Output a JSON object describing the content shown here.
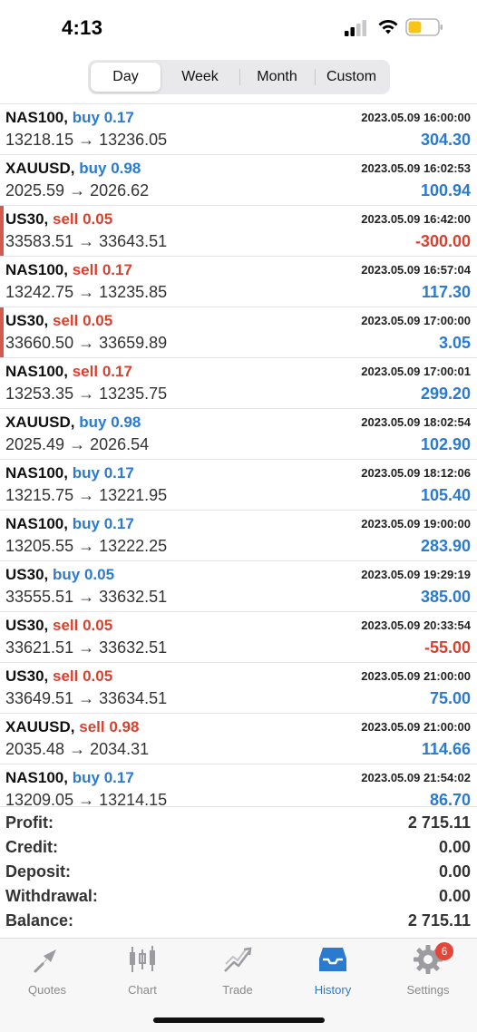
{
  "status_bar": {
    "time": "4:13"
  },
  "segments": [
    "Day",
    "Week",
    "Month",
    "Custom"
  ],
  "active_segment": "Day",
  "deals": [
    {
      "symbol": "NAS100,",
      "side": "buy",
      "volume": "0.17",
      "open": "13218.15",
      "close": "13236.05",
      "datetime": "2023.05.09 16:00:00",
      "profit": "304.30",
      "profit_sign": "pos",
      "marker": false
    },
    {
      "symbol": "XAUUSD,",
      "side": "buy",
      "volume": "0.98",
      "open": "2025.59",
      "close": "2026.62",
      "datetime": "2023.05.09 16:02:53",
      "profit": "100.94",
      "profit_sign": "pos",
      "marker": false
    },
    {
      "symbol": "US30,",
      "side": "sell",
      "volume": "0.05",
      "open": "33583.51",
      "close": "33643.51",
      "datetime": "2023.05.09 16:42:00",
      "profit": "-300.00",
      "profit_sign": "neg",
      "marker": true
    },
    {
      "symbol": "NAS100,",
      "side": "sell",
      "volume": "0.17",
      "open": "13242.75",
      "close": "13235.85",
      "datetime": "2023.05.09 16:57:04",
      "profit": "117.30",
      "profit_sign": "pos",
      "marker": false
    },
    {
      "symbol": "US30,",
      "side": "sell",
      "volume": "0.05",
      "open": "33660.50",
      "close": "33659.89",
      "datetime": "2023.05.09 17:00:00",
      "profit": "3.05",
      "profit_sign": "pos",
      "marker": true
    },
    {
      "symbol": "NAS100,",
      "side": "sell",
      "volume": "0.17",
      "open": "13253.35",
      "close": "13235.75",
      "datetime": "2023.05.09 17:00:01",
      "profit": "299.20",
      "profit_sign": "pos",
      "marker": false
    },
    {
      "symbol": "XAUUSD,",
      "side": "buy",
      "volume": "0.98",
      "open": "2025.49",
      "close": "2026.54",
      "datetime": "2023.05.09 18:02:54",
      "profit": "102.90",
      "profit_sign": "pos",
      "marker": false
    },
    {
      "symbol": "NAS100,",
      "side": "buy",
      "volume": "0.17",
      "open": "13215.75",
      "close": "13221.95",
      "datetime": "2023.05.09 18:12:06",
      "profit": "105.40",
      "profit_sign": "pos",
      "marker": false
    },
    {
      "symbol": "NAS100,",
      "side": "buy",
      "volume": "0.17",
      "open": "13205.55",
      "close": "13222.25",
      "datetime": "2023.05.09 19:00:00",
      "profit": "283.90",
      "profit_sign": "pos",
      "marker": false
    },
    {
      "symbol": "US30,",
      "side": "buy",
      "volume": "0.05",
      "open": "33555.51",
      "close": "33632.51",
      "datetime": "2023.05.09 19:29:19",
      "profit": "385.00",
      "profit_sign": "pos",
      "marker": false
    },
    {
      "symbol": "US30,",
      "side": "sell",
      "volume": "0.05",
      "open": "33621.51",
      "close": "33632.51",
      "datetime": "2023.05.09 20:33:54",
      "profit": "-55.00",
      "profit_sign": "neg",
      "marker": false
    },
    {
      "symbol": "US30,",
      "side": "sell",
      "volume": "0.05",
      "open": "33649.51",
      "close": "33634.51",
      "datetime": "2023.05.09 21:00:00",
      "profit": "75.00",
      "profit_sign": "pos",
      "marker": false
    },
    {
      "symbol": "XAUUSD,",
      "side": "sell",
      "volume": "0.98",
      "open": "2035.48",
      "close": "2034.31",
      "datetime": "2023.05.09 21:00:00",
      "profit": "114.66",
      "profit_sign": "pos",
      "marker": false
    },
    {
      "symbol": "NAS100,",
      "side": "buy",
      "volume": "0.17",
      "open": "13209.05",
      "close": "13214.15",
      "datetime": "2023.05.09 21:54:02",
      "profit": "86.70",
      "profit_sign": "pos",
      "marker": false
    }
  ],
  "arrow": "→",
  "summary": [
    {
      "label": "Profit:",
      "value": "2 715.11"
    },
    {
      "label": "Credit:",
      "value": "0.00"
    },
    {
      "label": "Deposit:",
      "value": "0.00"
    },
    {
      "label": "Withdrawal:",
      "value": "0.00"
    },
    {
      "label": "Balance:",
      "value": "2 715.11"
    }
  ],
  "tabs": [
    {
      "label": "Quotes",
      "icon": "quotes-icon"
    },
    {
      "label": "Chart",
      "icon": "chart-icon"
    },
    {
      "label": "Trade",
      "icon": "trade-icon"
    },
    {
      "label": "History",
      "icon": "history-icon"
    },
    {
      "label": "Settings",
      "icon": "settings-icon"
    }
  ],
  "active_tab": "History",
  "settings_badge": "6",
  "colors": {
    "buy": "#2a7bd0",
    "sell": "#d9412f",
    "accent": "#2a7bd0",
    "badge": "#e5463a",
    "marker": "#d45a4f",
    "battery": "#f5c518"
  }
}
